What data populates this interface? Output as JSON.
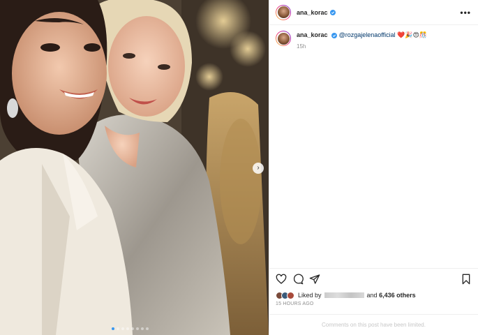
{
  "post": {
    "username": "ana_korac",
    "caption": {
      "username": "ana_korac",
      "mention": "@rozgajelenaofficial",
      "emojis": "❤️🎉😍🎊",
      "time": "15h"
    },
    "likes": {
      "liked_by": "Liked by",
      "and": "and",
      "others": "6,436 others"
    },
    "posted_ago": "15 HOURS AGO",
    "comments_notice": "Comments on this post have been limited."
  },
  "carousel": {
    "slide_count": 8,
    "active_index": 0
  },
  "icons": {
    "more": "more-options-icon",
    "like": "heart-icon",
    "comment": "comment-icon",
    "share": "share-icon",
    "save": "bookmark-icon",
    "verified": "verified-badge-icon",
    "next": "chevron-right-icon"
  },
  "colors": {
    "verified": "#3897f0",
    "mention": "#00376b",
    "muted": "#8e8e8e"
  }
}
